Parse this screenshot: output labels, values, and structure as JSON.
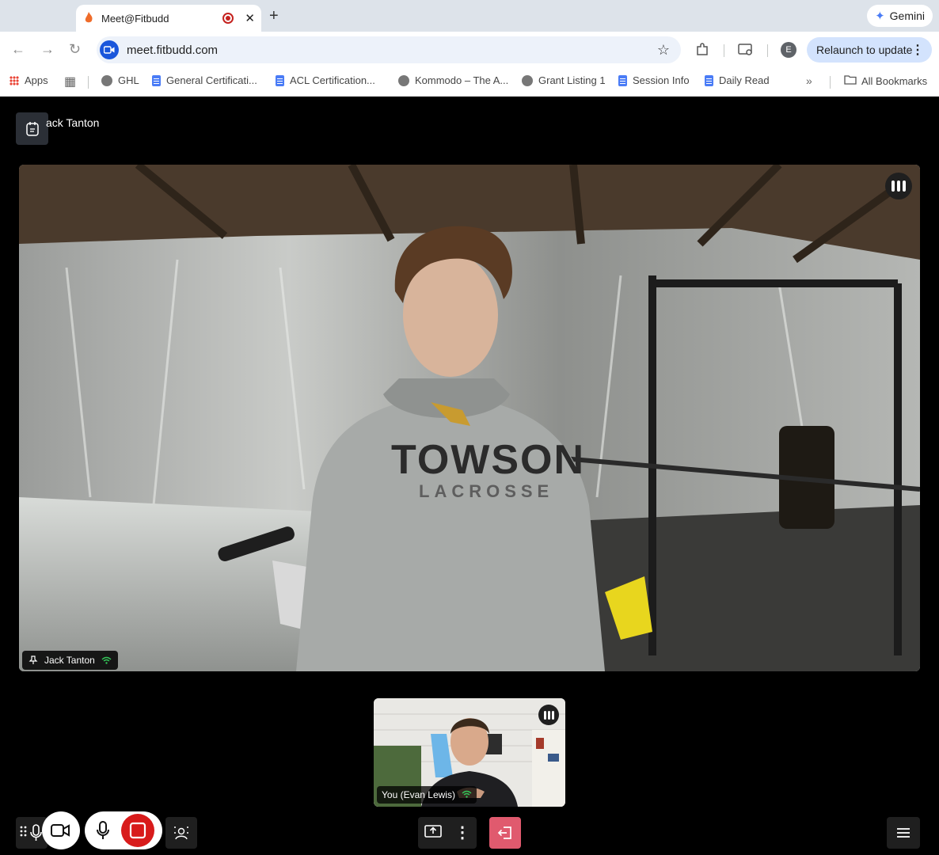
{
  "browser": {
    "tab_title": "Meet@Fitbudd",
    "new_tab_symbol": "+",
    "close_symbol": "✕",
    "gemini_label": "Gemini",
    "url": "meet.fitbudd.com",
    "profile_initial": "E",
    "relaunch_label": "Relaunch to update",
    "bookmarks": {
      "apps": "Apps",
      "ghl": "GHL",
      "general": "General Certificati...",
      "acl": "ACL Certification...",
      "kommodo": "Kommodo – The A...",
      "grant": "Grant Listing 1",
      "session": "Session Info",
      "daily": "Daily Read",
      "all": "All Bookmarks"
    }
  },
  "meeting": {
    "host_name": "ack Tanton",
    "main_participant": "Jack Tanton",
    "self_participant": "You (Evan Lewis)"
  },
  "colors": {
    "accent_blue": "#1a56db",
    "record_red": "#d81b1b",
    "leave_pink": "#e05a6e",
    "signal_green": "#34c759"
  }
}
